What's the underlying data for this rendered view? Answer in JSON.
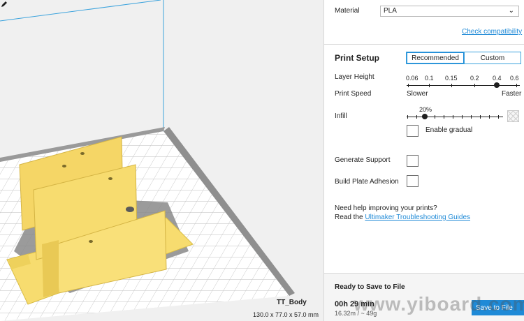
{
  "viewport": {
    "object_name": "TT_Body",
    "object_dims": "130.0 x 77.0 x 57.0 mm"
  },
  "sidebar": {
    "material": {
      "label": "Material",
      "value": "PLA",
      "check_link": "Check compatibility"
    },
    "print_setup": {
      "title": "Print Setup",
      "tabs": [
        {
          "label": "Recommended",
          "active": true
        },
        {
          "label": "Custom",
          "active": false
        }
      ],
      "layer_height": {
        "label": "Layer Height",
        "ticks": [
          "0.06",
          "0.1",
          "0.15",
          "0.2",
          "0.4",
          "0.6"
        ],
        "selected": "0.4"
      },
      "print_speed": {
        "label": "Print Speed",
        "min_label": "Slower",
        "max_label": "Faster"
      },
      "infill": {
        "label": "Infill",
        "value_label": "20%",
        "value": 20
      },
      "enable_gradual": "Enable gradual",
      "generate_support": "Generate Support",
      "build_plate_adhesion": "Build Plate Adhesion",
      "help_line1": "Need help improving your prints?",
      "help_prefix": "Read the",
      "help_link": "Ultimaker Troubleshooting Guides"
    },
    "footer": {
      "title": "Ready to Save to File",
      "time": "00h 29 min",
      "material_usage": "16.32m / ~ 49g",
      "save_label": "Save to File"
    }
  },
  "watermark": "www.yiboard.com",
  "colors": {
    "accent": "#1f8ad7",
    "model": "#f7dc6f",
    "grid": "#c5c5c5"
  }
}
